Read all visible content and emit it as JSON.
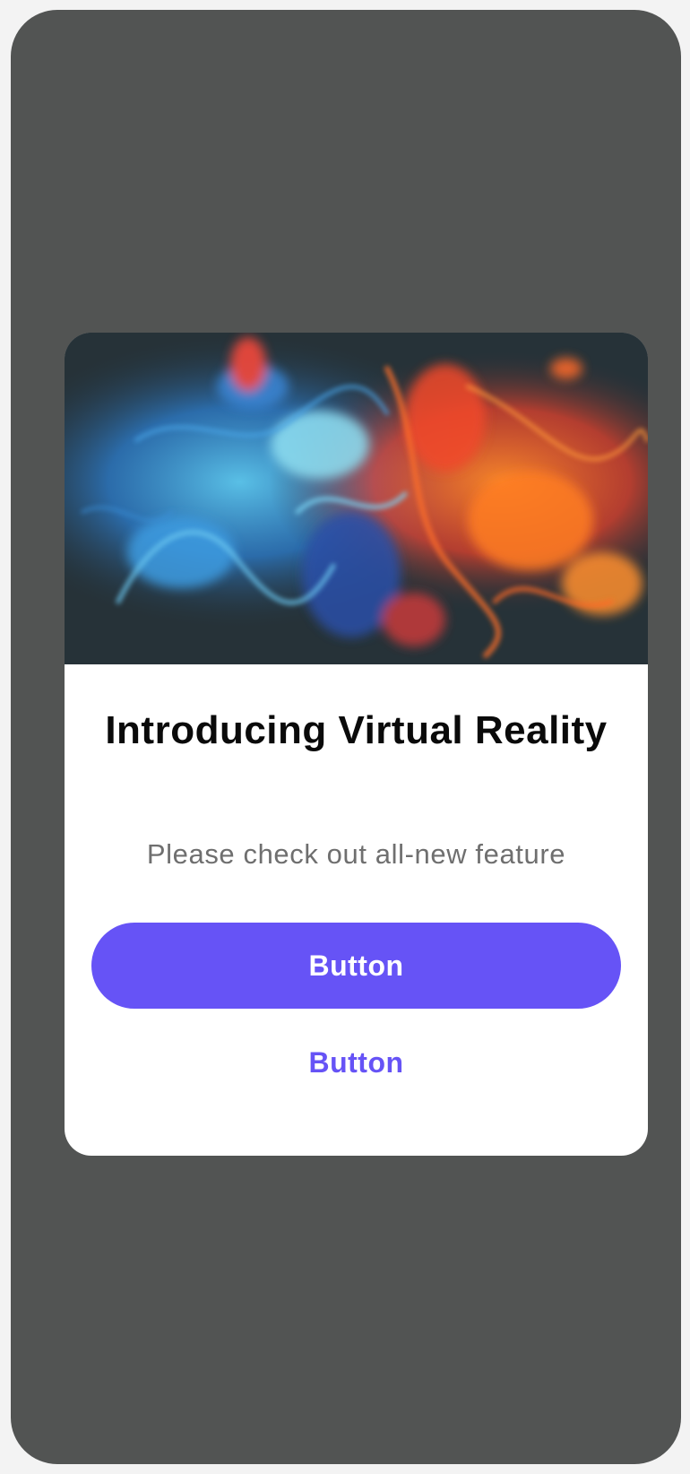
{
  "colors": {
    "screen_background": "#525453",
    "card_background": "#ffffff",
    "accent": "#6653f6",
    "title_text": "#0a0a0a",
    "subtitle_text": "#6f6f6f"
  },
  "modal": {
    "image_icon": "abstract-ink-smoke-image",
    "title": "Introducing Virtual Reality",
    "subtitle": "Please check out all-new feature",
    "primary_button_label": "Button",
    "secondary_button_label": "Button"
  }
}
